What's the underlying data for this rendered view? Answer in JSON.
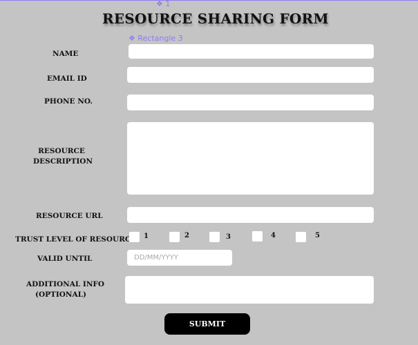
{
  "overlay": {
    "frame_tag": "❖ 1",
    "component_tag": "❖ Rectangle 3"
  },
  "form": {
    "title": "RESOURCE SHARING FORM",
    "fields": {
      "name": {
        "label": "NAME",
        "value": ""
      },
      "email": {
        "label": "EMAIL ID",
        "value": ""
      },
      "phone": {
        "label": "PHONE NO.",
        "value": ""
      },
      "description": {
        "label_line1": "RESOURCE",
        "label_line2": "DESCRIPTION",
        "value": ""
      },
      "url": {
        "label": "RESOURCE URL",
        "value": ""
      },
      "trust": {
        "label": "TRUST LEVEL OF RESOURCE",
        "options": [
          "1",
          "2",
          "3",
          "4",
          "5"
        ]
      },
      "valid_until": {
        "label": "VALID UNTIL",
        "placeholder": "DD/MM/YYYY",
        "value": ""
      },
      "additional": {
        "label_line1": "ADDITIONAL INFO",
        "label_line2": "(OPTIONAL)",
        "value": ""
      }
    },
    "submit_label": "SUBMIT"
  },
  "colors": {
    "background": "#c4c4c4",
    "field": "#ffffff",
    "button": "#000000",
    "overlay_accent": "#8b7cf6"
  }
}
